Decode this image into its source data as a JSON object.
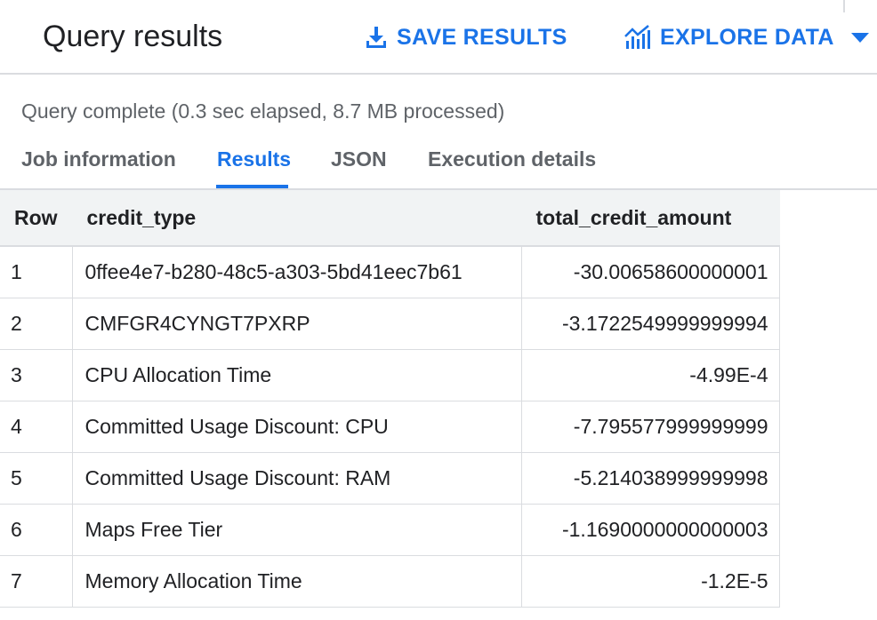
{
  "header": {
    "title": "Query results",
    "save_label": "SAVE RESULTS",
    "explore_label": "EXPLORE DATA"
  },
  "status_text": "Query complete (0.3 sec elapsed, 8.7 MB processed)",
  "tabs": [
    {
      "label": "Job information",
      "active": false
    },
    {
      "label": "Results",
      "active": true
    },
    {
      "label": "JSON",
      "active": false
    },
    {
      "label": "Execution details",
      "active": false
    }
  ],
  "table": {
    "columns": [
      "Row",
      "credit_type",
      "total_credit_amount"
    ],
    "rows": [
      {
        "row": "1",
        "credit_type": "0ffee4e7-b280-48c5-a303-5bd41eec7b61",
        "total_credit_amount": "-30.00658600000001"
      },
      {
        "row": "2",
        "credit_type": "CMFGR4CYNGT7PXRP",
        "total_credit_amount": "-3.1722549999999994"
      },
      {
        "row": "3",
        "credit_type": "CPU Allocation Time",
        "total_credit_amount": "-4.99E-4"
      },
      {
        "row": "4",
        "credit_type": "Committed Usage Discount: CPU",
        "total_credit_amount": "-7.795577999999999"
      },
      {
        "row": "5",
        "credit_type": "Committed Usage Discount: RAM",
        "total_credit_amount": "-5.214038999999998"
      },
      {
        "row": "6",
        "credit_type": "Maps Free Tier",
        "total_credit_amount": "-1.1690000000000003"
      },
      {
        "row": "7",
        "credit_type": "Memory Allocation Time",
        "total_credit_amount": "-1.2E-5"
      }
    ]
  },
  "colors": {
    "accent": "#1a73e8",
    "text": "#202124",
    "muted": "#5f6368",
    "divider": "#dadce0",
    "header_bg": "#f1f3f4"
  },
  "icons": {
    "save": "download-icon",
    "explore": "chart-icon",
    "dropdown": "caret-down-icon"
  }
}
